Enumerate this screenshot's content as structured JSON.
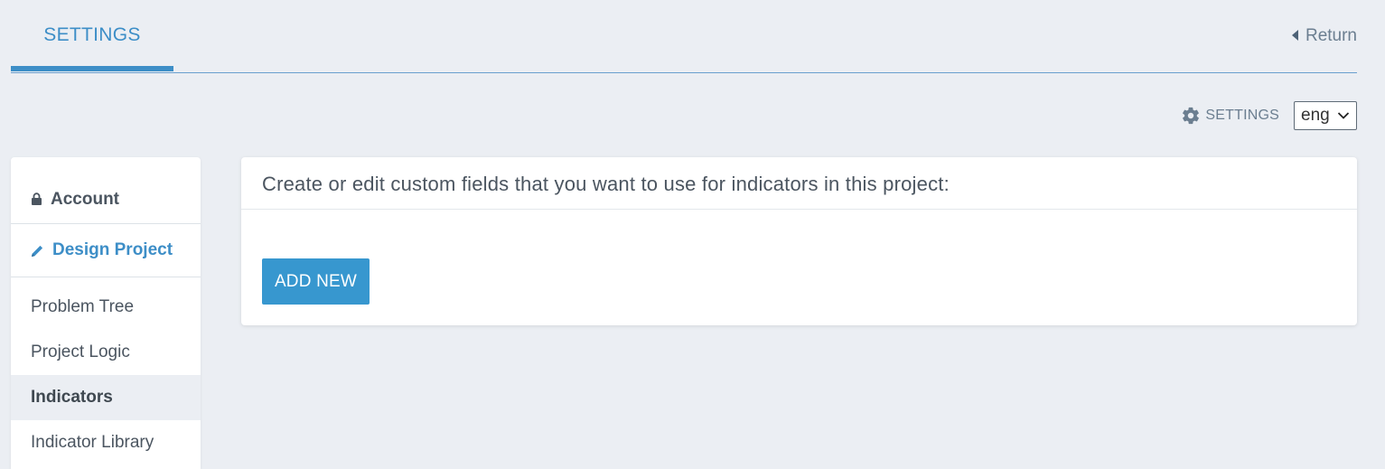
{
  "header": {
    "tab_label": "SETTINGS",
    "return_label": "Return"
  },
  "toolbar": {
    "settings_label": "SETTINGS",
    "language": "eng"
  },
  "sidebar": {
    "sections": [
      {
        "label": "Account",
        "icon": "lock-icon"
      },
      {
        "label": "Design Project",
        "icon": "pencil-icon"
      }
    ],
    "items": [
      {
        "label": "Problem Tree"
      },
      {
        "label": "Project Logic"
      },
      {
        "label": "Indicators"
      },
      {
        "label": "Indicator Library"
      }
    ],
    "selected_item": "Indicators"
  },
  "panel": {
    "description": "Create or edit custom fields that you want to use for indicators in this project:",
    "add_button_label": "ADD NEW"
  },
  "colors": {
    "accent": "#3d8ec7",
    "button": "#3797cf",
    "background": "#ebeef3"
  }
}
